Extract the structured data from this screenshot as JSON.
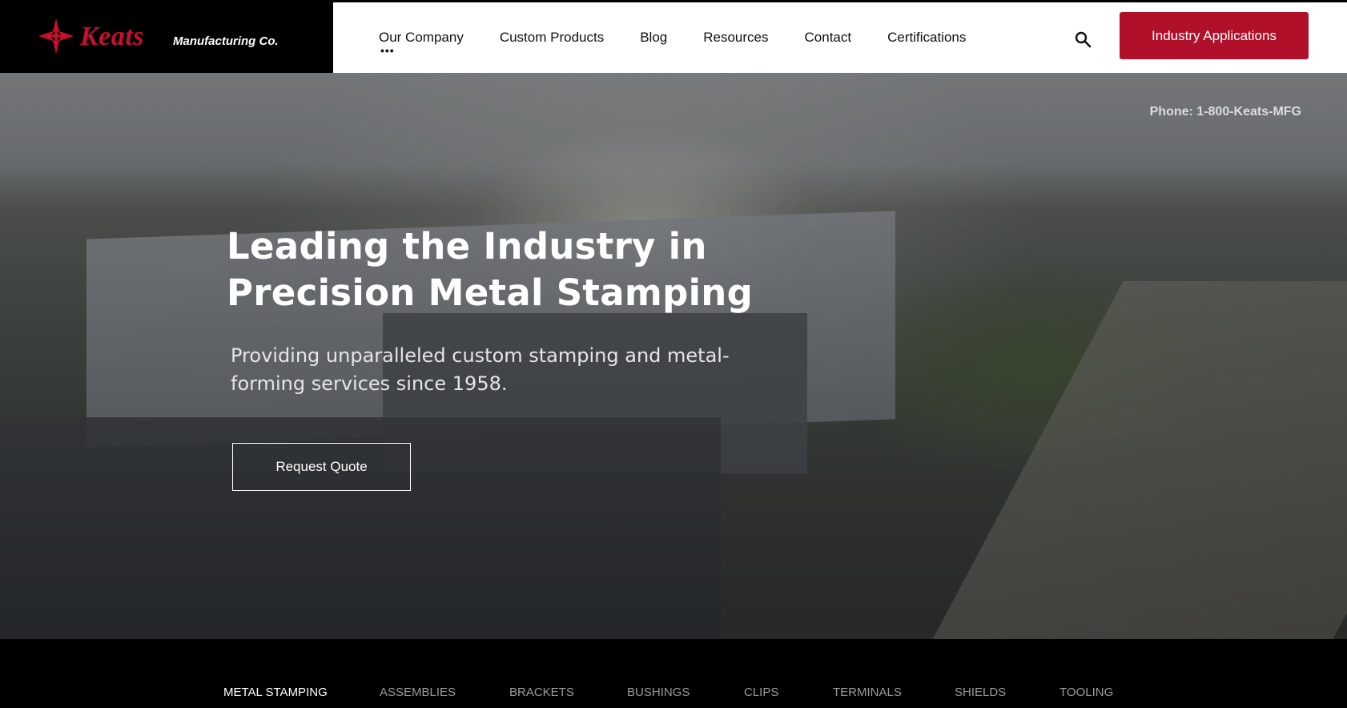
{
  "brand": {
    "name": "Keats",
    "tagline": "Manufacturing Co.",
    "logo_color": "#c8102e"
  },
  "nav": {
    "items": [
      {
        "label": "Our Company",
        "has_dropdown_dots": true,
        "dots": "•••"
      },
      {
        "label": "Custom Products"
      },
      {
        "label": "Blog"
      },
      {
        "label": "Resources"
      },
      {
        "label": "Contact"
      },
      {
        "label": "Certifications"
      }
    ],
    "search_icon": "search-icon",
    "cta_label": "Industry Applications",
    "cta_color": "#b0102a"
  },
  "hero": {
    "phone": "Phone: 1-800-Keats-MFG",
    "title_line1": "Leading the Industry in",
    "title_line2": "Precision Metal Stamping",
    "subtitle": "Providing unparalleled custom stamping and metal-forming services since 1958.",
    "button_label": "Request Quote"
  },
  "subnav": {
    "items": [
      {
        "label": "METAL STAMPING",
        "active": true
      },
      {
        "label": "ASSEMBLIES"
      },
      {
        "label": "BRACKETS"
      },
      {
        "label": "BUSHINGS"
      },
      {
        "label": "CLIPS"
      },
      {
        "label": "TERMINALS"
      },
      {
        "label": "SHIELDS"
      },
      {
        "label": "TOOLING"
      }
    ]
  }
}
